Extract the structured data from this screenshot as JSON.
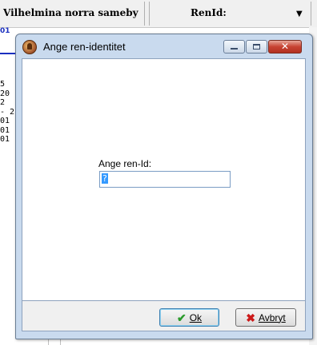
{
  "background": {
    "header_title": "Vilhelmina norra sameby",
    "column_header": "RenId:",
    "dropdown_arrow": "▼",
    "top_left_snippet": "01",
    "left_column_fragments": [
      "5",
      "20",
      "2",
      "- 2",
      "01",
      "01",
      "01"
    ]
  },
  "dialog": {
    "title": "Ange ren-identitet",
    "icon": "app-icon",
    "controls": {
      "minimize": "minimize-icon",
      "maximize": "maximize-icon",
      "close": "✕"
    },
    "field_label": "Ange ren-Id:",
    "field_value": "?",
    "buttons": {
      "ok": {
        "label": "Ok",
        "icon": "checkmark-icon",
        "icon_glyph": "✔"
      },
      "cancel": {
        "label": "Avbryt",
        "icon": "x-icon",
        "icon_glyph": "✖"
      }
    }
  }
}
